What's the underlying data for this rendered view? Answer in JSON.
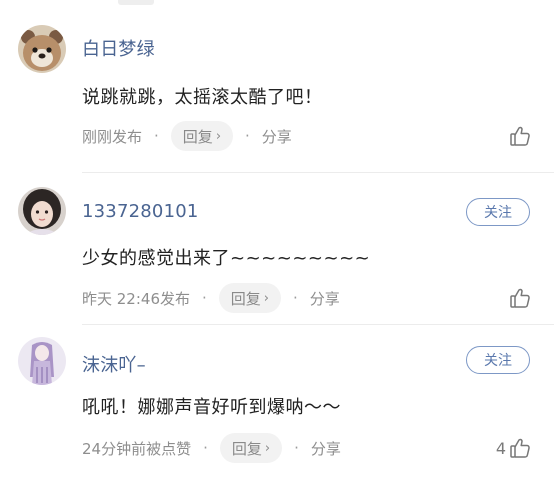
{
  "comments": [
    {
      "username": "白日梦绿",
      "text": "说跳就跳，太摇滚太酷了吧！",
      "time": "刚刚发布",
      "reply_label": "回复",
      "share_label": "分享",
      "like_count": "",
      "follow_label": "",
      "avatar_icon": "bear-avatar"
    },
    {
      "username": "1337280101",
      "text": "少女的感觉出来了~~~~~~~~~",
      "time": "昨天 22:46发布",
      "reply_label": "回复",
      "share_label": "分享",
      "like_count": "",
      "follow_label": "关注",
      "avatar_icon": "girl-avatar"
    },
    {
      "username": "沫沫吖–",
      "text": "吼吼！娜娜声音好听到爆呐～～",
      "time": "24分钟前被点赞",
      "reply_label": "回复",
      "share_label": "分享",
      "like_count": "4",
      "follow_label": "关注",
      "avatar_icon": "illustration-avatar"
    }
  ],
  "colors": {
    "username": "#4a6491",
    "follow": "#5a78ad",
    "meta": "#8e8e8e"
  }
}
